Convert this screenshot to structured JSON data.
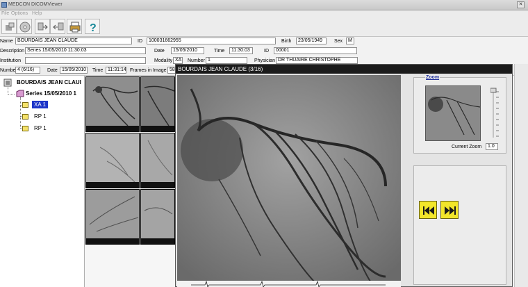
{
  "window": {
    "title": "MEDCON DICOMViewer"
  },
  "menu": {
    "items": [
      "File",
      "Options",
      "Help"
    ]
  },
  "toolbar": {
    "icons": [
      "open-study-icon",
      "cd-disk-icon",
      "import-icon",
      "export-icon",
      "print-icon",
      "help-icon"
    ]
  },
  "patient": {
    "name_label": "Name",
    "name_value": "BOURDAIS JEAN CLAUDE",
    "id_label": "ID",
    "id_value": "100031662955",
    "birth_label": "Birth",
    "birth_value": "23/05/1949",
    "sex_label": "Sex",
    "sex_value": "M",
    "description_label": "Description",
    "description_value": "Series 15/05/2010 11:30:03",
    "date_label": "Date",
    "date_value": "15/05/2010",
    "time_label": "Time",
    "time_value": "11:30:03",
    "series_id_label": "ID",
    "series_id_value": "00001",
    "institution_label": "Institution",
    "institution_value": "",
    "modality_label": "Modality",
    "modality_value": "XA",
    "number_label": "Number",
    "number_value": "1",
    "physician_label": "Physician",
    "physician_value": "DR THUAIRE CHRISTOPHE"
  },
  "info": {
    "number_label": "Number",
    "number_value": "4 (6/16)",
    "date_label": "Date",
    "date_value": "15/05/2010",
    "time_label": "Time",
    "time_value": "11:31:14",
    "frames_label": "Frames in Image",
    "frames_value": "58"
  },
  "tree": {
    "patient": "BOURDAIS JEAN CLAUI",
    "series": "Series 15/05/2010 1",
    "items": [
      "XA 1",
      "RP 1",
      "RP 1"
    ]
  },
  "viewer": {
    "title": "BOURDAIS JEAN CLAUDE (3/16)",
    "zoom_label": "Zoom",
    "current_zoom_label": "Current Zoom",
    "current_zoom_value": "1.0"
  },
  "colors": {
    "selected": "#1d35c8",
    "nav_button": "#f2e62a",
    "titlebar_dark": "#1b1b1b"
  }
}
